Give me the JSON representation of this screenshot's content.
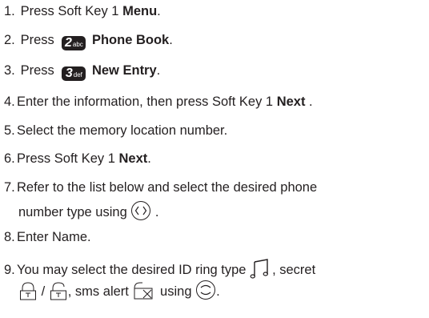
{
  "steps": [
    {
      "num": "1.",
      "pre": "Press Soft Key 1 ",
      "bold": "Menu",
      "post": "."
    },
    {
      "num": "2.",
      "pre": "Press",
      "key_digit": "2",
      "key_letters": "abc",
      "bold": "Phone Book",
      "post": "."
    },
    {
      "num": "3.",
      "pre": "Press",
      "key_digit": "3",
      "key_letters": "def",
      "bold": "New Entry",
      "post": "."
    },
    {
      "num": "4.",
      "pre": "Enter the information, then press Soft Key 1 ",
      "bold": "Next",
      "post": " ."
    },
    {
      "num": "5.",
      "pre": "Select the memory location number."
    },
    {
      "num": "6.",
      "pre": "Press Soft Key 1 ",
      "bold": "Next",
      "post": "."
    },
    {
      "num": "7.",
      "line1": "Refer to the list below and select the desired phone",
      "line2_pre": "number type using",
      "line2_post": " ."
    },
    {
      "num": "8.",
      "pre": "Enter Name."
    },
    {
      "num": "9.",
      "line1_pre": "You may select the desired ID ring type",
      "line1_post": ", secret",
      "line2_mid": " / ",
      "line2_mid2": ", sms alert",
      "line2_mid3": " using",
      "line2_post": "."
    }
  ],
  "icons": [
    "music-note-icon",
    "lock-icon",
    "unlock-icon",
    "message-icon",
    "nav-left-right-icon",
    "nav-up-down-icon"
  ]
}
